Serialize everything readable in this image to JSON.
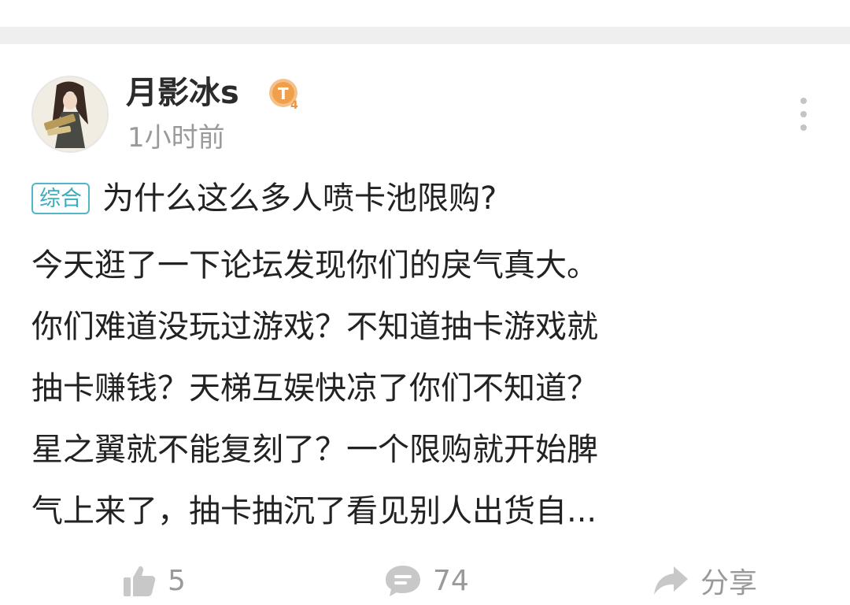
{
  "post": {
    "username": "月影冰s",
    "level_badge": "T4",
    "timestamp": "1小时前",
    "category_tag": "综合",
    "title": "为什么这么多人喷卡池限购?",
    "body_lines": [
      "今天逛了一下论坛发现你们的戾气真大。",
      "你们难道没玩过游戏？不知道抽卡游戏就",
      "抽卡赚钱？天梯互娱快凉了你们不知道？",
      "星之翼就不能复刻了？一个限购就开始脾",
      "气上来了，抽卡抽沉了看见别人出货自..."
    ]
  },
  "actions": {
    "like_count": "5",
    "comment_count": "74",
    "share_label": "分享"
  },
  "colors": {
    "tag_border": "#4fb7c6",
    "icon_gray": "#c8c8c8",
    "badge_orange": "#f0a04b"
  }
}
